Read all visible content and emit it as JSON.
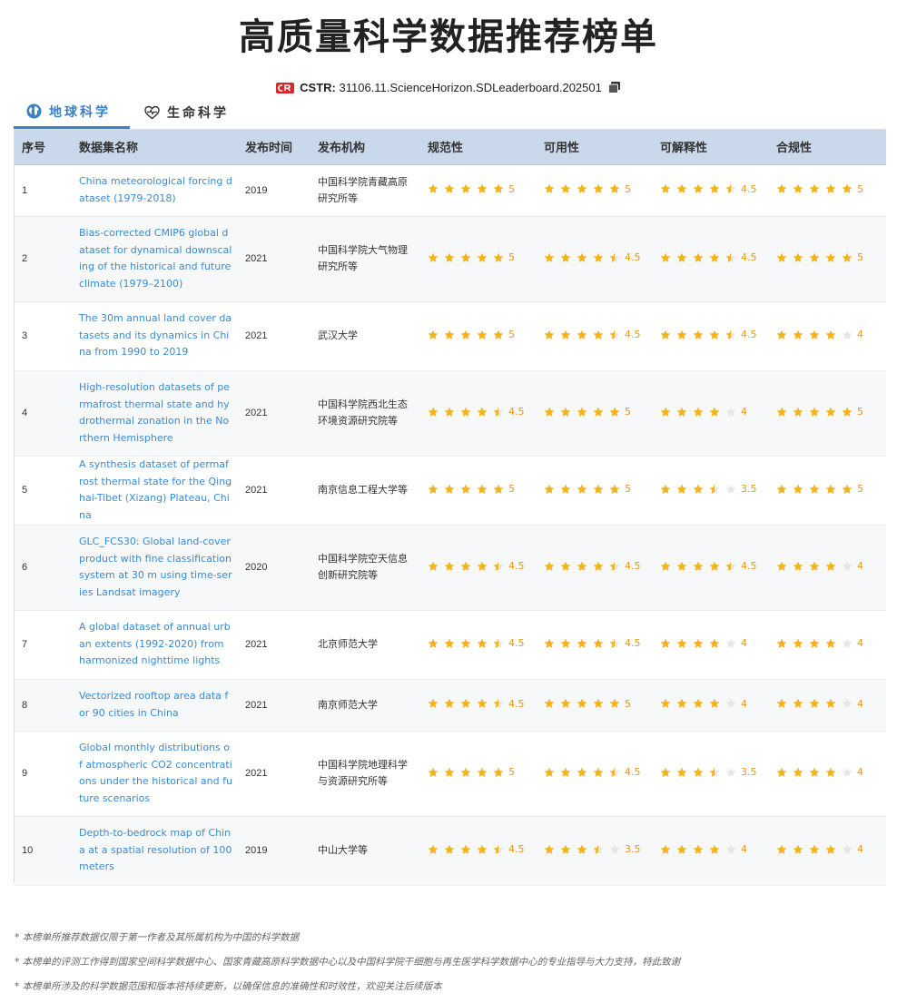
{
  "page": {
    "title": "高质量科学数据推荐榜单",
    "cstr_label": "CSTR:",
    "cstr_value": "31106.11.ScienceHorizon.SDLeaderboard.202501"
  },
  "tabs": [
    {
      "label": "地球科学",
      "icon": "globe-icon",
      "active": true
    },
    {
      "label": "生命科学",
      "icon": "heart-pulse-icon",
      "active": false
    }
  ],
  "table": {
    "headers": [
      "序号",
      "数据集名称",
      "发布时间",
      "发布机构",
      "规范性",
      "可用性",
      "可解释性",
      "合规性"
    ],
    "rows": [
      {
        "index": "1",
        "name": "China meteorological forcing dataset (1979-2018)",
        "year": "2019",
        "org": "中国科学院青藏高原研究所等",
        "ratings": [
          5,
          5,
          4.5,
          5
        ],
        "labels": [
          "5",
          "5",
          "4.5",
          "5"
        ]
      },
      {
        "index": "2",
        "name": "Bias-corrected CMIP6 global dataset for dynamical downscaling of the historical and future climate (1979–2100)",
        "year": "2021",
        "org": "中国科学院大气物理研究所等",
        "ratings": [
          5,
          4.5,
          4.5,
          5
        ],
        "labels": [
          "5",
          "4.5",
          "4.5",
          "5"
        ]
      },
      {
        "index": "3",
        "name": "The 30m annual land cover datasets and its dynamics in China from 1990 to 2019",
        "year": "2021",
        "org": "武汉大学",
        "ratings": [
          5,
          4.5,
          4.5,
          4
        ],
        "labels": [
          "5",
          "4.5",
          "4.5",
          "4"
        ]
      },
      {
        "index": "4",
        "name": "High-resolution datasets of permafrost thermal state and hydrothermal zonation in the Northern Hemisphere",
        "year": "2021",
        "org": "中国科学院西北生态环境资源研究院等",
        "ratings": [
          4.5,
          5,
          4,
          5
        ],
        "labels": [
          "4.5",
          "5",
          "4",
          "5"
        ]
      },
      {
        "index": "5",
        "name": "A synthesis dataset of permafrost thermal state for the Qinghai-Tibet (Xizang) Plateau, China",
        "year": "2021",
        "org": "南京信息工程大学等",
        "ratings": [
          5,
          5,
          3.5,
          5
        ],
        "labels": [
          "5",
          "5",
          "3.5",
          "5"
        ]
      },
      {
        "index": "6",
        "name": "GLC_FCS30: Global land-cover product with fine classification system at 30 m using time-series Landsat imagery",
        "year": "2020",
        "org": "中国科学院空天信息创新研究院等",
        "ratings": [
          4.5,
          4.5,
          4.5,
          4
        ],
        "labels": [
          "4.5",
          "4.5",
          "4.5",
          "4"
        ]
      },
      {
        "index": "7",
        "name": "A global dataset of annual urban extents (1992-2020) from harmonized nighttime lights",
        "year": "2021",
        "org": "北京师范大学",
        "ratings": [
          4.5,
          4.5,
          4,
          4
        ],
        "labels": [
          "4.5",
          "4.5",
          "4",
          "4"
        ]
      },
      {
        "index": "8",
        "name": "Vectorized rooftop area data for 90 cities in China",
        "year": "2021",
        "org": "南京师范大学",
        "ratings": [
          4.5,
          5,
          4,
          4
        ],
        "labels": [
          "4.5",
          "5",
          "4",
          "4"
        ]
      },
      {
        "index": "9",
        "name": "Global monthly distributions of atmospheric CO2 concentrations under the historical and future scenarios",
        "year": "2021",
        "org": "中国科学院地理科学与资源研究所等",
        "ratings": [
          5,
          4.5,
          3.5,
          4
        ],
        "labels": [
          "5",
          "4.5",
          "3.5",
          "4"
        ]
      },
      {
        "index": "10",
        "name": "Depth-to-bedrock map of China at a spatial resolution of 100 meters",
        "year": "2019",
        "org": "中山大学等",
        "ratings": [
          4.5,
          3.5,
          4,
          4
        ],
        "labels": [
          "4.5",
          "3.5",
          "4",
          "4"
        ]
      }
    ]
  },
  "notes": [
    "* 本榜单所推荐数据仅限于第一作者及其所属机构为中国的科学数据",
    "* 本榜单的评测工作得到国家空间科学数据中心、国家青藏高原科学数据中心以及中国科学院干细胞与再生医学科学数据中心的专业指导与大力支持，特此致谢",
    "* 本榜单所涉及的科学数据范围和版本将持续更新，以确保信息的准确性和时效性，欢迎关注后续版本"
  ],
  "colors": {
    "accent": "#3b7fc4",
    "star": "#f5b21b",
    "star_empty": "#e6e6e6",
    "score": "#e79a14",
    "header_bg": "#c9d8ea"
  }
}
